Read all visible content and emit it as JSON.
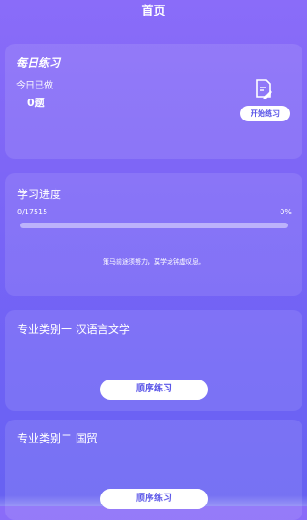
{
  "header": {
    "title": "首页"
  },
  "daily": {
    "title": "每日练习",
    "done_label": "今日已做",
    "done_count": "0题",
    "start_button": "开始练习",
    "icon": "document-edit-icon"
  },
  "progress": {
    "title": "学习进度",
    "count": "0/17515",
    "percent_label": "0%",
    "percent_value": 0,
    "quote": "策马前途须努力，莫学龙钟虚叹息。"
  },
  "categories": [
    {
      "title": "专业类别一  汉语言文学",
      "button": "顺序练习"
    },
    {
      "title": "专业类别二  国贸",
      "button": "顺序练习"
    }
  ],
  "colors": {
    "background_top": "#8a6cf9",
    "background_bottom": "#6762f2",
    "button_text": "#5b56e8"
  }
}
